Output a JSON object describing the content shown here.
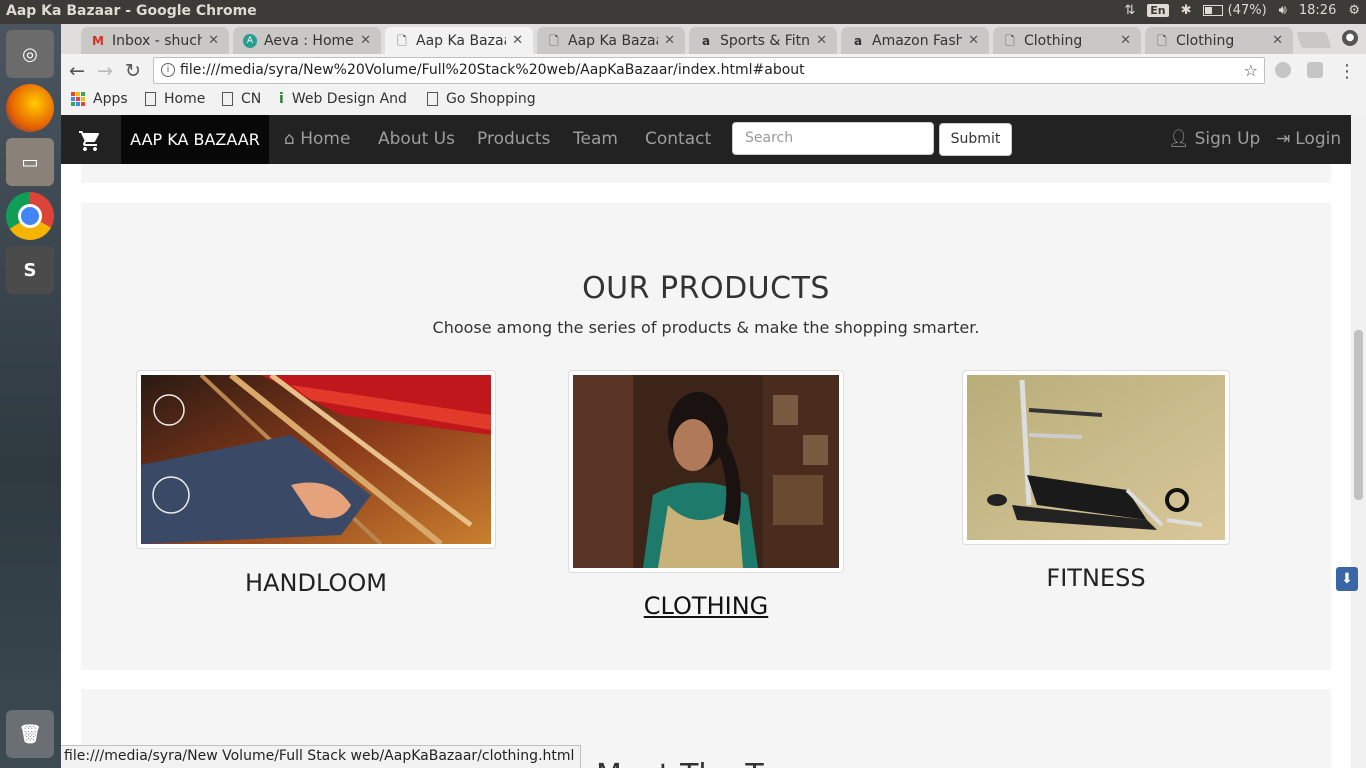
{
  "os": {
    "window_title": "Aap Ka Bazaar - Google Chrome",
    "keyboard": "En",
    "battery": "(47%)",
    "time": "18:26"
  },
  "tabs": [
    {
      "title": "Inbox - shuch",
      "icon": "gmail-icon",
      "active": false
    },
    {
      "title": "Aeva : Home",
      "icon": "aeva-icon",
      "active": false
    },
    {
      "title": "Aap Ka Bazaa",
      "icon": "page-icon",
      "active": true
    },
    {
      "title": "Aap Ka Bazaa",
      "icon": "page-icon",
      "active": false
    },
    {
      "title": "Sports & Fitn",
      "icon": "amazon-icon",
      "active": false
    },
    {
      "title": "Amazon Fash",
      "icon": "amazon-icon",
      "active": false
    },
    {
      "title": "Clothing",
      "icon": "page-icon",
      "active": false
    },
    {
      "title": "Clothing",
      "icon": "page-icon",
      "active": false
    }
  ],
  "address": {
    "url": "file:///media/syra/New%20Volume/Full%20Stack%20web/AapKaBazaar/index.html#about"
  },
  "bookmarks": {
    "apps": "Apps",
    "items": [
      "Home",
      "CN",
      "Web Design And",
      "Go Shopping"
    ]
  },
  "site": {
    "brand": "AAP KA BAZAAR",
    "nav": {
      "home": "Home",
      "about": "About Us",
      "products": "Products",
      "team": "Team",
      "contact": "Contact"
    },
    "search_placeholder": "Search",
    "submit": "Submit",
    "signup": "Sign Up",
    "login": "Login",
    "products_section": {
      "title": "OUR PRODUCTS",
      "subtitle": "Choose among the series of products & make the shopping smarter.",
      "items": [
        {
          "label": "HANDLOOM"
        },
        {
          "label": "CLOTHING"
        },
        {
          "label": "FITNESS"
        }
      ]
    },
    "next_section_title_partial": "Meet The T"
  },
  "status_url": "file:///media/syra/New Volume/Full Stack web/AapKaBazaar/clothing.html",
  "colors": {
    "navbar": "#222222",
    "brand_bg": "#080808",
    "well": "#f5f5f5",
    "nav_text": "#9d9d9d"
  }
}
